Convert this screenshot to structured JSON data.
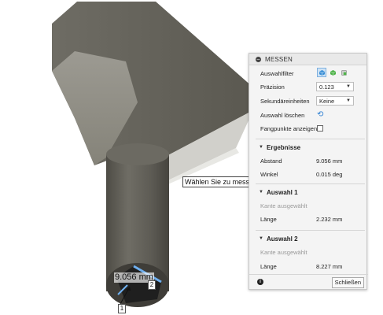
{
  "viewport": {
    "dimension_label": "9.056 mm",
    "marker_1": "1",
    "marker_2": "2",
    "tooltip": "Wählen Sie zu messende Objekte aus."
  },
  "panel": {
    "title": "MESSEN",
    "rows": {
      "filter_label": "Auswahlfilter",
      "precision_label": "Präzision",
      "precision_value": "0.123",
      "secondary_units_label": "Sekundäreinheiten",
      "secondary_units_value": "Keine",
      "clear_selection_label": "Auswahl löschen",
      "show_snap_points_label": "Fangpunkte anzeigen"
    },
    "results": {
      "heading": "Ergebnisse",
      "distance_label": "Abstand",
      "distance_value": "9.056 mm",
      "angle_label": "Winkel",
      "angle_value": "0.015 deg"
    },
    "selection1": {
      "heading": "Auswahl 1",
      "sub": "Kante ausgewählt",
      "length_label": "Länge",
      "length_value": "2.232 mm"
    },
    "selection2": {
      "heading": "Auswahl 2",
      "sub": "Kante ausgewählt",
      "length_label": "Länge",
      "length_value": "8.227 mm"
    },
    "footer": {
      "close_label": "Schließen"
    }
  },
  "colors": {
    "model_dark": "#5f5d55",
    "model_mid": "#7a786f",
    "model_light": "#9a9890",
    "accent_blue": "#2d7fd2"
  },
  "icons": [
    "collapse-icon",
    "body-filter-icon",
    "face-filter-icon",
    "edge-filter-icon",
    "reset-icon",
    "info-icon"
  ]
}
